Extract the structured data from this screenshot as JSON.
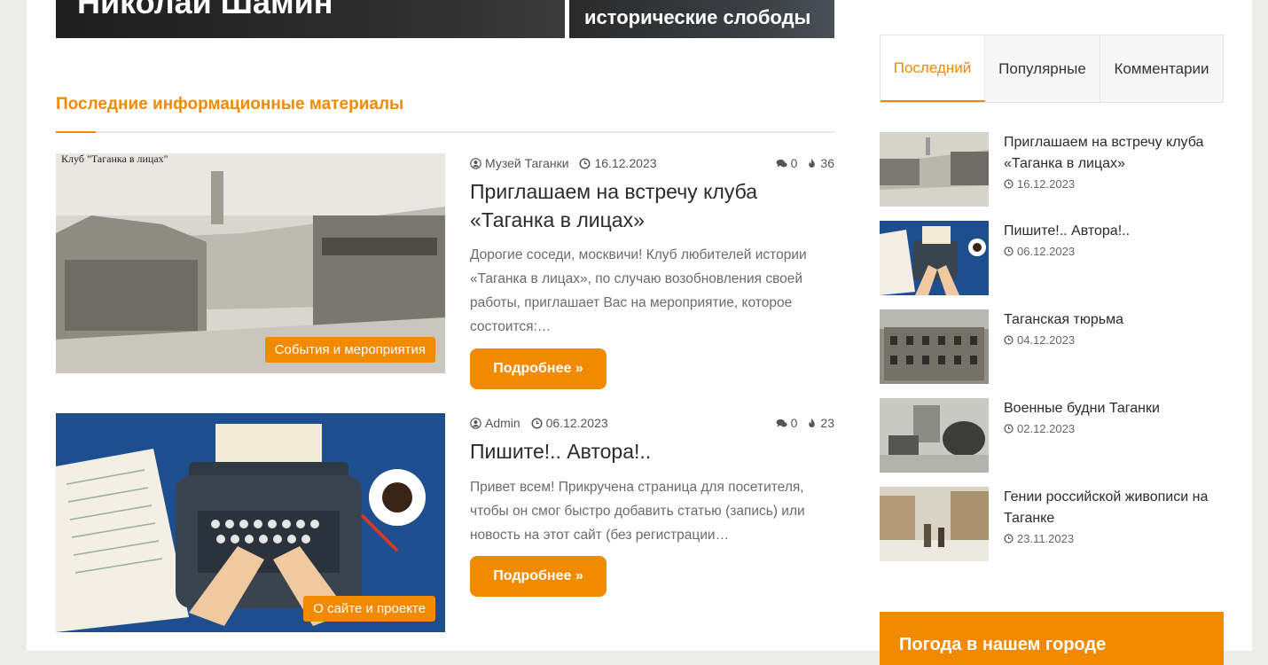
{
  "hero": {
    "left_title": "Николай Шамин",
    "right_title": "исторические слободы"
  },
  "latest": {
    "heading": "Последние информационные материалы"
  },
  "posts": [
    {
      "author": "Музей Таганки",
      "date": "16.12.2023",
      "comments": "0",
      "views": "36",
      "title": "Приглашаем на встречу клуба «Таганка в лицах»",
      "excerpt": "Дорогие соседи, москвичи! Клуб любителей истории «Таганка в лицах», по случаю возобновления своей работы, приглашает Вас на мероприятие, которое состоится:…",
      "category": "События и мероприятия",
      "button": "Подробнее »"
    },
    {
      "author": "Admin",
      "date": "06.12.2023",
      "comments": "0",
      "views": "23",
      "title": "Пишите!.. Автора!..",
      "excerpt": "Привет всем! Прикручена страница для посетителя, чтобы он смог быстро добавить статью (запись) или новость на этот сайт (без регистрации…",
      "category": "О сайте и проекте",
      "button": "Подробнее »"
    }
  ],
  "sidebar": {
    "tabs": [
      "Последний",
      "Популярные",
      "Комментарии"
    ],
    "active_tab": "Последний",
    "items": [
      {
        "title": "Приглашаем на встречу клуба «Таганка в лицах»",
        "date": "16.12.2023"
      },
      {
        "title": "Пишите!.. Автора!..",
        "date": "06.12.2023"
      },
      {
        "title": "Таганская тюрьма",
        "date": "04.12.2023"
      },
      {
        "title": "Военные будни Таганки",
        "date": "02.12.2023"
      },
      {
        "title": "Гении российской живописи на Таганке",
        "date": "23.11.2023"
      }
    ],
    "weather_title": "Погода в нашем городе"
  },
  "colors": {
    "accent": "#f28a00",
    "text": "#2b2b2b",
    "muted": "#6b6b6b"
  },
  "icons": [
    "user-icon",
    "clock-icon",
    "comments-icon",
    "fire-icon"
  ]
}
